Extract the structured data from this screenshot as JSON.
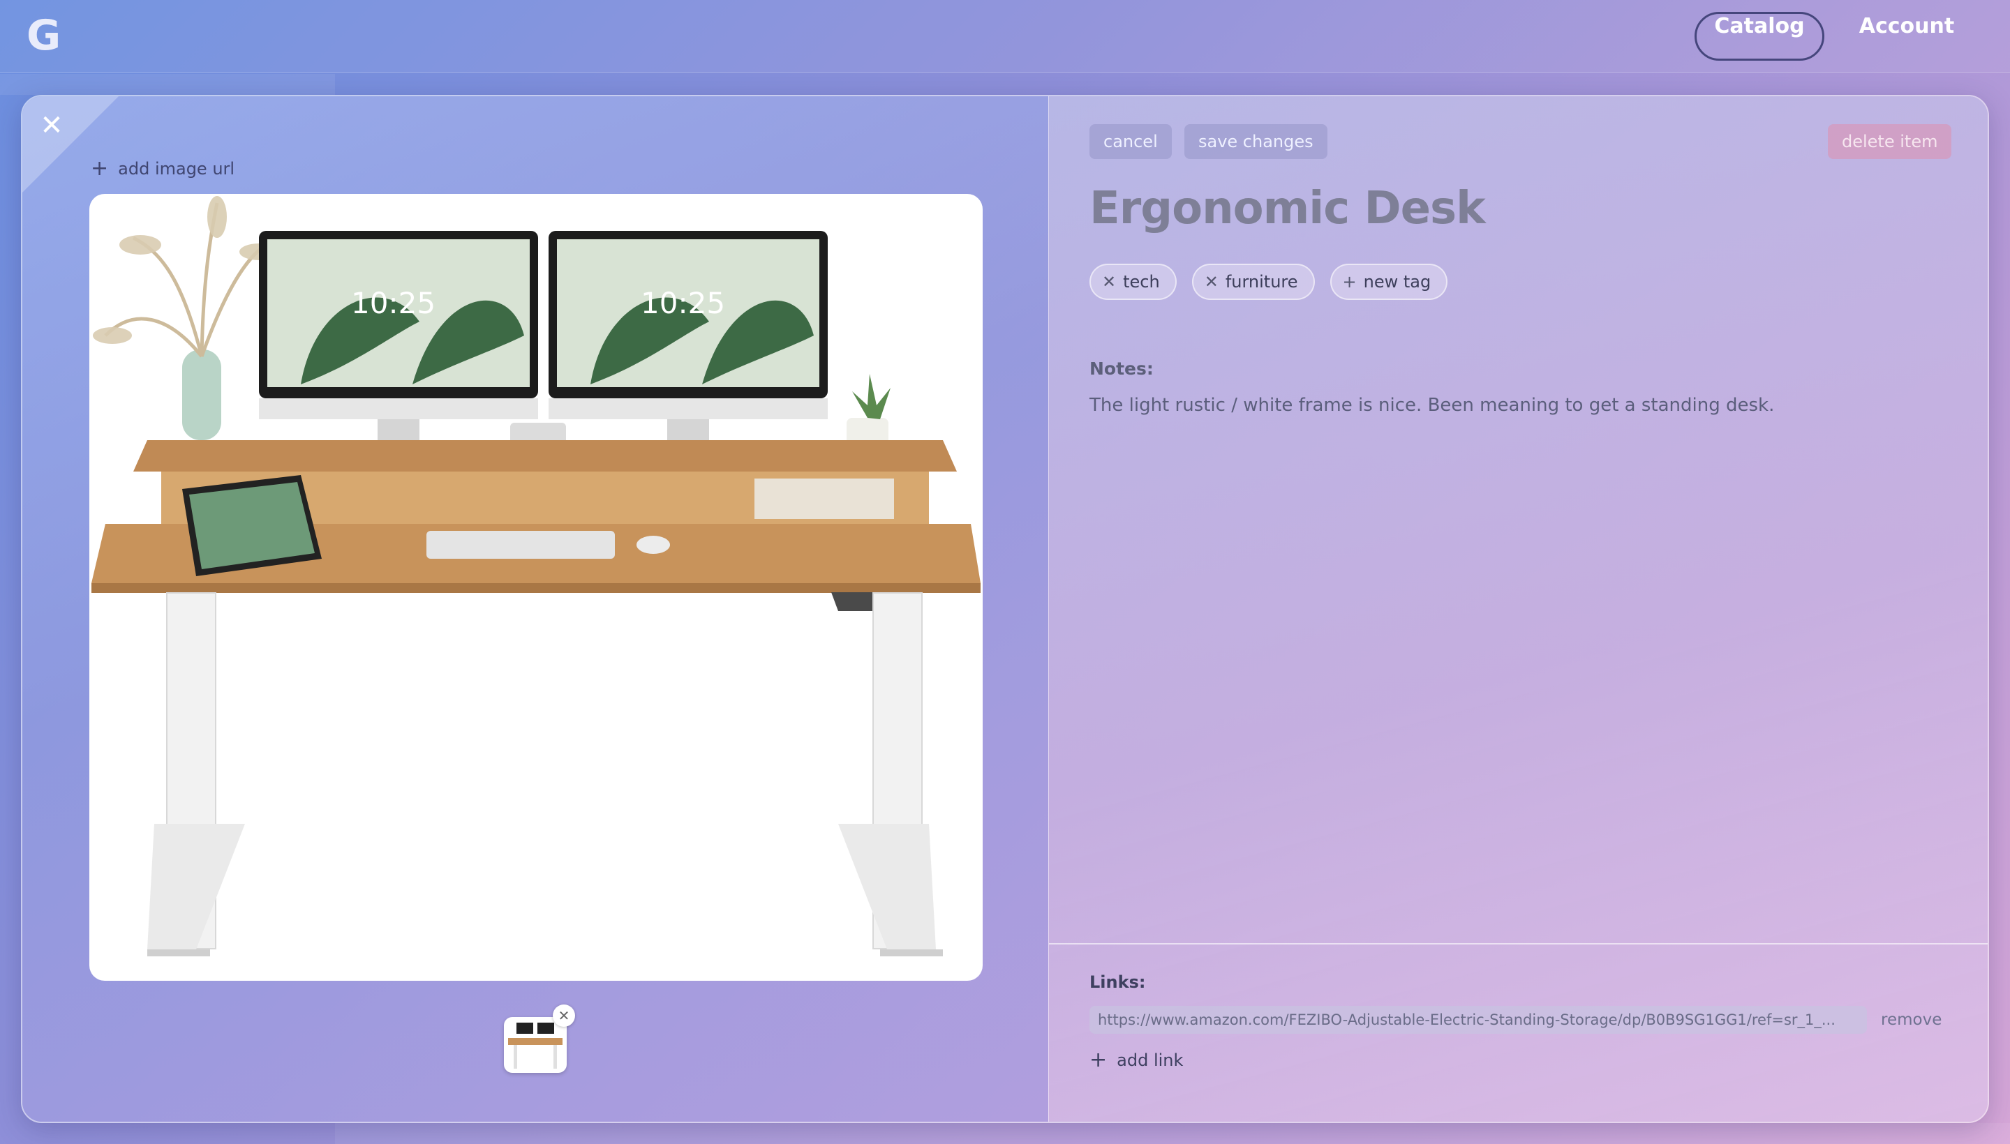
{
  "header": {
    "logo_letter": "G",
    "nav": [
      {
        "label": "Catalog"
      },
      {
        "label": "Account"
      }
    ]
  },
  "modal": {
    "close_icon": "close-icon",
    "add_image_label": "add image url",
    "actions": {
      "cancel": "cancel",
      "save": "save changes",
      "delete": "delete item"
    },
    "title": "Ergonomic Desk",
    "tags": [
      {
        "label": "tech"
      },
      {
        "label": "furniture"
      }
    ],
    "new_tag_label": "new tag",
    "notes_label": "Notes:",
    "notes_text": "The light rustic / white frame is nice. Been meaning to get a standing desk.",
    "links_label": "Links:",
    "links": [
      {
        "url": "https://www.amazon.com/FEZIBO-Adjustable-Electric-Standing-Storage/dp/B0B9SG1GG1/ref=sr_1_...",
        "remove_label": "remove"
      }
    ],
    "add_link_label": "add link",
    "image_clock_text": "10:25"
  },
  "colors": {
    "accent_dark": "#45467c",
    "title_gray": "#7e7f97",
    "delete_pink": "#e18caa"
  }
}
